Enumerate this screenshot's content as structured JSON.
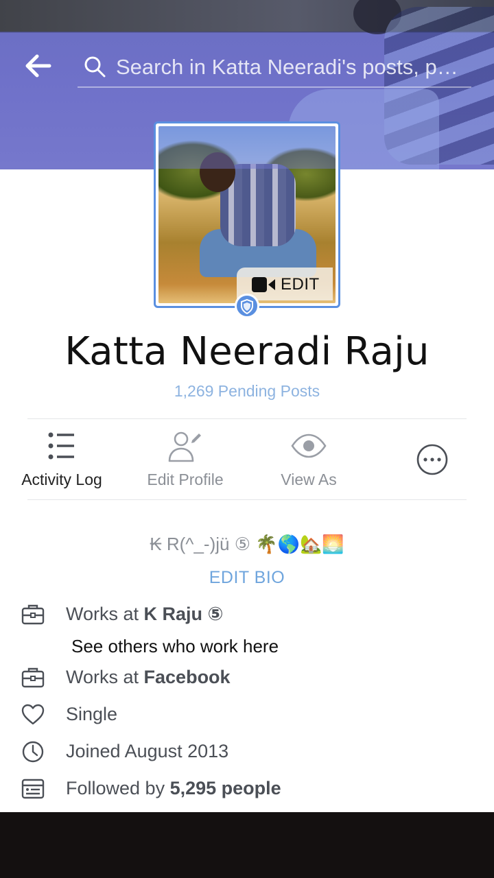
{
  "search": {
    "placeholder": "Search in Katta Neeradi's posts, p…"
  },
  "profile": {
    "name": "Katta Neeradi Raju",
    "pending_posts": "1,269 Pending Posts",
    "avatar_edit_label": "EDIT"
  },
  "actions": [
    {
      "label": "Activity Log",
      "icon": "list-icon"
    },
    {
      "label": "Edit Profile",
      "icon": "edit-profile-icon"
    },
    {
      "label": "View As",
      "icon": "eye-icon"
    },
    {
      "label": "",
      "icon": "more-icon"
    }
  ],
  "bio": {
    "text": "₭ R(^_-)jü ⑤ 🌴🌎🏡🌅",
    "edit_label": "EDIT BIO"
  },
  "details": {
    "work1_prefix": "Works at ",
    "work1_company": "K Raju ⑤",
    "see_others": "See others who work here",
    "work2_prefix": "Works at ",
    "work2_company": "Facebook",
    "relationship": "Single",
    "joined": "Joined August 2013",
    "followed_prefix": "Followed by ",
    "followed_count": "5,295 people"
  },
  "colors": {
    "accent": "#5a8fe0",
    "link": "#6fa5dd",
    "pending": "#8db3e0",
    "muted": "#8b8f96"
  }
}
